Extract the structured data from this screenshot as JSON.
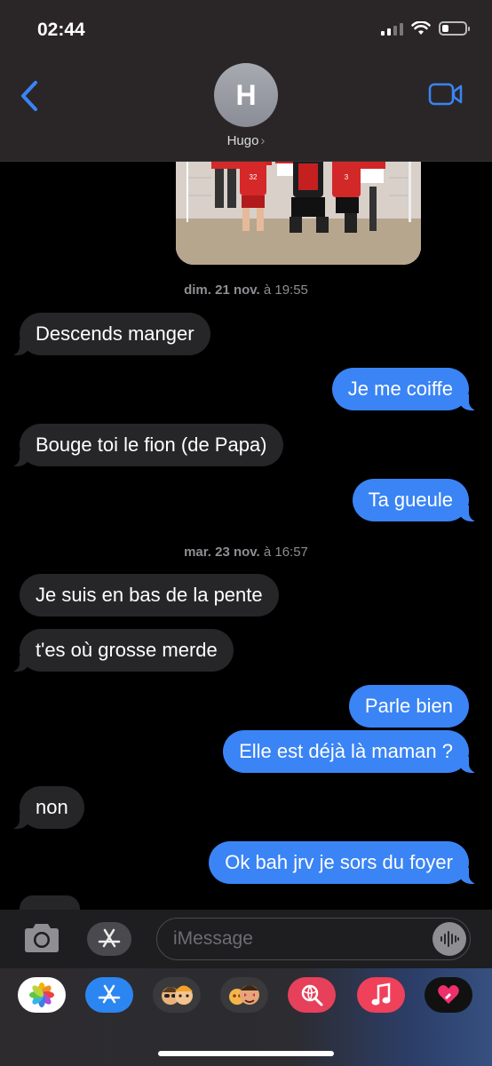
{
  "status_bar": {
    "time": "02:44"
  },
  "header": {
    "avatar_initial": "H",
    "contact_name": "Hugo",
    "contact_chevron": "›"
  },
  "colors": {
    "incoming_bubble": "#262629",
    "outgoing_bubble": "#3a84f5",
    "background": "#000000"
  },
  "conversation": {
    "timestamp_1": {
      "day": "dim. 21 nov.",
      "time": " à 19:55"
    },
    "msg_1": "Descends manger",
    "msg_2": "Je me coiffe",
    "msg_3": "Bouge toi le fion (de Papa)",
    "msg_4": "Ta gueule",
    "timestamp_2": {
      "day": "mar. 23 nov.",
      "time": " à 16:57"
    },
    "msg_5": "Je suis en bas de la pente",
    "msg_6": "t'es où grosse merde",
    "msg_7": "Parle bien",
    "msg_8": "Elle est déjà là maman ?",
    "msg_9": "non",
    "msg_10": "Ok bah jrv je sors du foyer"
  },
  "composer": {
    "placeholder": "iMessage"
  },
  "app_tray": [
    "photos-icon",
    "app-store-icon",
    "memoji-icon",
    "memoji-stickers-icon",
    "image-search-icon",
    "music-icon",
    "digital-touch-icon"
  ]
}
